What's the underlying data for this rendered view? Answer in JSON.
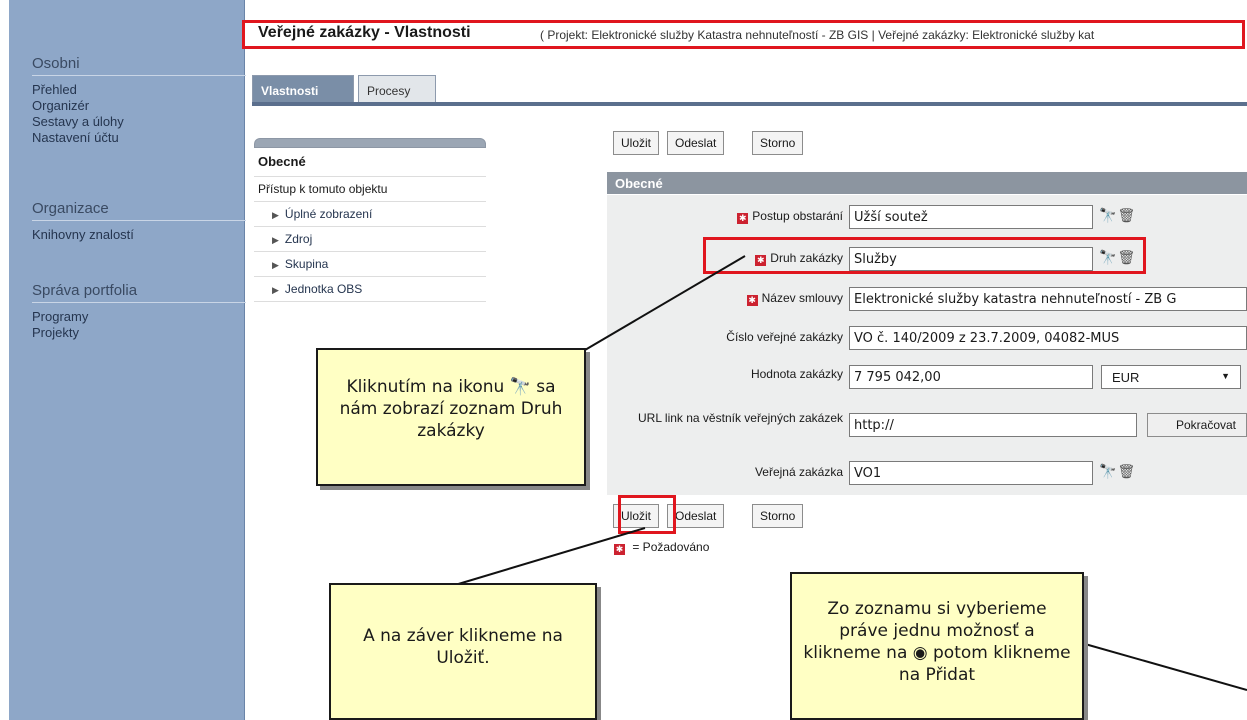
{
  "sidebar": {
    "sections": [
      {
        "title": "Osobni",
        "items": [
          "Přehled",
          "Organizér",
          "Sestavy a úlohy",
          "Nastavení účtu"
        ]
      },
      {
        "title": "Organizace",
        "items": [
          "Knihovny znalostí"
        ]
      },
      {
        "title": "Správa portfolia",
        "items": [
          "Programy",
          "Projekty"
        ]
      }
    ]
  },
  "header": {
    "title": "Veřejné zakázky - Vlastnosti",
    "subtitle": "( Projekt: Elektronické služby Katastra nehnuteľností - ZB GIS | Veřejné zakázky: Elektronické služby kat"
  },
  "tabs": [
    "Vlastnosti",
    "Procesy"
  ],
  "leftnav": {
    "main": "Obecné",
    "access": "Přístup k tomuto objektu",
    "items": [
      "Úplné zobrazení",
      "Zdroj",
      "Skupina",
      "Jednotka OBS"
    ]
  },
  "toolbar": {
    "save": "Uložit",
    "send": "Odeslat",
    "cancel": "Storno"
  },
  "section": "Obecné",
  "form": {
    "postup_label": "Postup obstarání",
    "postup_value": "Užší soutež",
    "druh_label": "Druh zakázky",
    "druh_value": "Služby",
    "nazev_label": "Název smlouvy",
    "nazev_value": "Elektronické služby katastra nehnuteľností - ZB G",
    "cislo_label": "Číslo veřejné zakázky",
    "cislo_value": "VO č. 140/2009 z 23.7.2009, 04082-MUS",
    "hodnota_label": "Hodnota zakázky",
    "hodnota_value": "7 795 042,00",
    "currency": "EUR",
    "url_label": "URL link na věstník veřejných zakázek",
    "url_value": "http://",
    "continue": "Pokračovat",
    "vz_label": "Veřejná zakázka",
    "vz_value": "VO1"
  },
  "legend": "= Požadováno",
  "notes": {
    "note1": "Kliknutím na ikonu 🔭 sa nám zobrazí zoznam Druh zakázky",
    "note2": "A na záver klikneme na Uložiť.",
    "note3": "Zo zoznamu si vyberieme práve jednu možnosť a klikneme na ◉ potom klikneme na Přidat"
  },
  "colors": {
    "accent_red": "#e0161e",
    "sidebar": "#8ea7c8",
    "note_bg": "#ffffc4"
  }
}
